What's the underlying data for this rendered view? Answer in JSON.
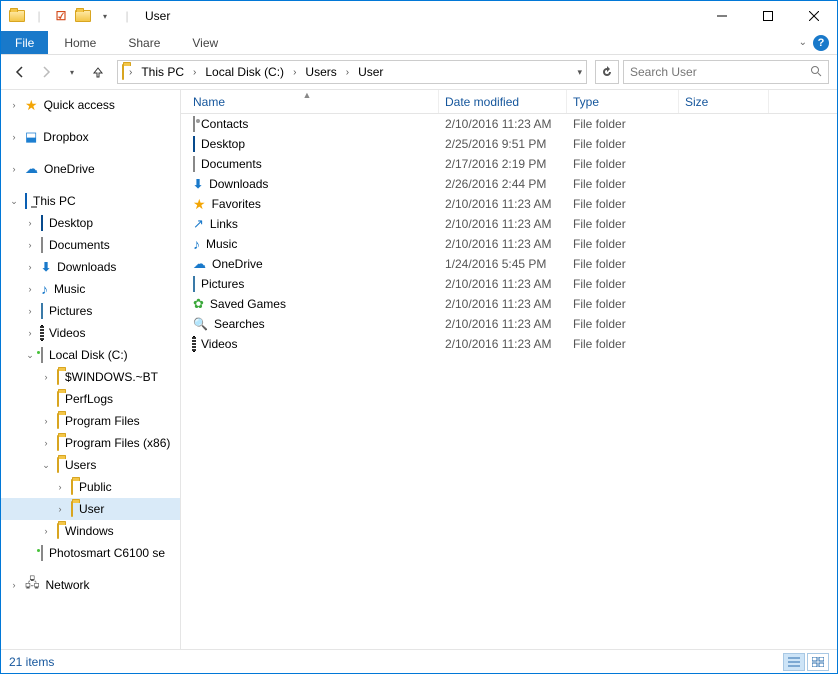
{
  "window": {
    "title": "User"
  },
  "tabs": {
    "file": "File",
    "home": "Home",
    "share": "Share",
    "view": "View"
  },
  "breadcrumb": [
    "This PC",
    "Local Disk (C:)",
    "Users",
    "User"
  ],
  "search": {
    "placeholder": "Search User"
  },
  "columns": {
    "name": "Name",
    "date": "Date modified",
    "type": "Type",
    "size": "Size"
  },
  "tree": {
    "quick": "Quick access",
    "dropbox": "Dropbox",
    "onedrive": "OneDrive",
    "thispc": "This PC",
    "desktop": "Desktop",
    "documents": "Documents",
    "downloads": "Downloads",
    "music": "Music",
    "pictures": "Pictures",
    "videos": "Videos",
    "localdisk": "Local Disk (C:)",
    "winbt": "$WINDOWS.~BT",
    "perflogs": "PerfLogs",
    "progfiles": "Program Files",
    "progfiles86": "Program Files (x86)",
    "users": "Users",
    "public": "Public",
    "user": "User",
    "windows": "Windows",
    "photosmart": "Photosmart C6100 se",
    "network": "Network"
  },
  "items": [
    {
      "icon": "contacts",
      "name": "Contacts",
      "date": "2/10/2016 11:23 AM",
      "type": "File folder"
    },
    {
      "icon": "desk",
      "name": "Desktop",
      "date": "2/25/2016 9:51 PM",
      "type": "File folder"
    },
    {
      "icon": "doc",
      "name": "Documents",
      "date": "2/17/2016 2:19 PM",
      "type": "File folder"
    },
    {
      "icon": "dl",
      "name": "Downloads",
      "date": "2/26/2016 2:44 PM",
      "type": "File folder"
    },
    {
      "icon": "star",
      "name": "Favorites",
      "date": "2/10/2016 11:23 AM",
      "type": "File folder"
    },
    {
      "icon": "link",
      "name": "Links",
      "date": "2/10/2016 11:23 AM",
      "type": "File folder"
    },
    {
      "icon": "music",
      "name": "Music",
      "date": "2/10/2016 11:23 AM",
      "type": "File folder"
    },
    {
      "icon": "cloud",
      "name": "OneDrive",
      "date": "1/24/2016 5:45 PM",
      "type": "File folder"
    },
    {
      "icon": "pic",
      "name": "Pictures",
      "date": "2/10/2016 11:23 AM",
      "type": "File folder"
    },
    {
      "icon": "games",
      "name": "Saved Games",
      "date": "2/10/2016 11:23 AM",
      "type": "File folder"
    },
    {
      "icon": "search",
      "name": "Searches",
      "date": "2/10/2016 11:23 AM",
      "type": "File folder"
    },
    {
      "icon": "vid",
      "name": "Videos",
      "date": "2/10/2016 11:23 AM",
      "type": "File folder"
    }
  ],
  "status": {
    "count": "21 items"
  }
}
